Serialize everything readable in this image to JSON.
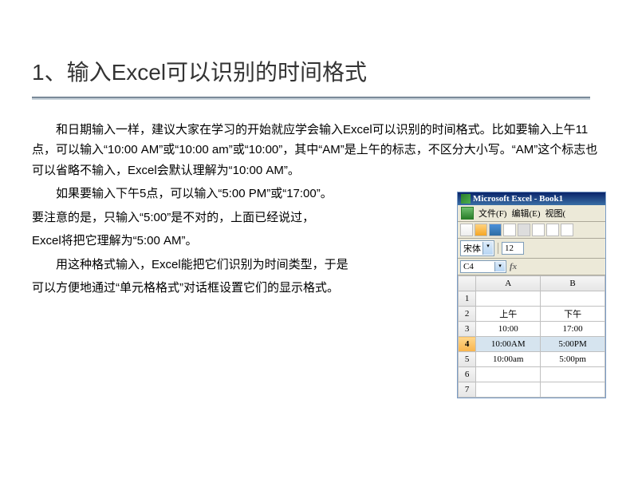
{
  "title": "1、输入Excel可以识别的时间格式",
  "paragraphs": {
    "p1": "和日期输入一样，建议大家在学习的开始就应学会输入Excel可以识别的时间格式。比如要输入上午11点，可以输入“10:00 AM”或“10:00 am”或“10:00”，其中“AM”是上午的标志，不区分大小写。“AM”这个标志也可以省略不输入，Excel会默认理解为“10:00 AM”。",
    "p2": "如果要输入下午5点，可以输入“5:00 PM”或“17:00”。",
    "p3": "要注意的是，只输入“5:00”是不对的，上面已经说过，",
    "p4": "Excel将把它理解为“5:00 AM”。",
    "p5": "用这种格式输入，Excel能把它们识别为时间类型，于是",
    "p6": "可以方便地通过“单元格格式”对话框设置它们的显示格式。"
  },
  "excel": {
    "window_title": "Microsoft Excel - Book1",
    "menu": {
      "file": "文件(F)",
      "edit": "编辑(E)",
      "view": "视图("
    },
    "font_name": "宋体",
    "font_size": "12",
    "address_cell": "C4",
    "fx_label": "fx",
    "columns": [
      "A",
      "B"
    ],
    "rows": [
      {
        "num": "1",
        "a": "",
        "b": ""
      },
      {
        "num": "2",
        "a": "上午",
        "b": "下午"
      },
      {
        "num": "3",
        "a": "10:00",
        "b": "17:00"
      },
      {
        "num": "4",
        "a": "10:00AM",
        "b": "5:00PM"
      },
      {
        "num": "5",
        "a": "10:00am",
        "b": "5:00pm"
      },
      {
        "num": "6",
        "a": "",
        "b": ""
      },
      {
        "num": "7",
        "a": "",
        "b": ""
      }
    ]
  }
}
